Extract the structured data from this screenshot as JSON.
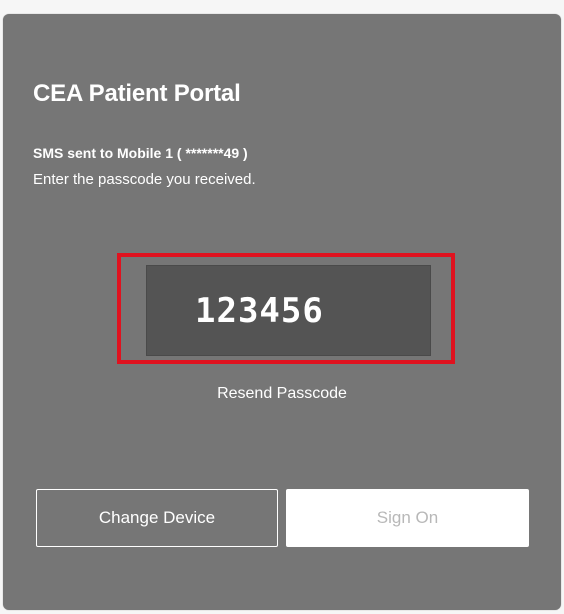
{
  "portal": {
    "title": "CEA Patient Portal",
    "sms_notice": "SMS sent to Mobile 1 ( *******49 )",
    "instructions": "Enter the passcode you received.",
    "passcode_value": "123456",
    "resend_label": "Resend Passcode"
  },
  "actions": {
    "change_device_label": "Change Device",
    "sign_on_label": "Sign On"
  },
  "colors": {
    "card_background": "#767676",
    "input_background": "#545454",
    "highlight_border": "#e0121f",
    "primary_button_background": "#ffffff",
    "primary_button_text_disabled": "#b8b8b8"
  }
}
